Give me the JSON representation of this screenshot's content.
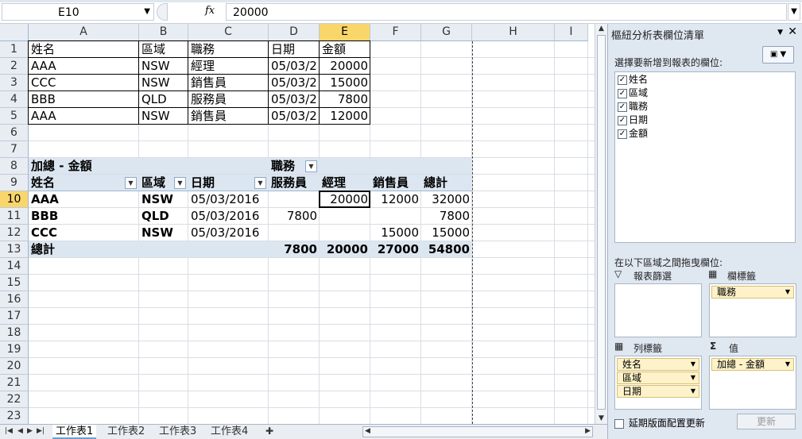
{
  "formula_bar": {
    "cell_ref": "E10",
    "fx": "fx",
    "value": "20000"
  },
  "columns": [
    "A",
    "B",
    "C",
    "D",
    "E",
    "F",
    "G",
    "H",
    "I"
  ],
  "selected_column": "E",
  "rows": [
    "1",
    "2",
    "3",
    "4",
    "5",
    "6",
    "7",
    "8",
    "9",
    "10",
    "11",
    "12",
    "13",
    "14",
    "15",
    "16",
    "17",
    "18",
    "19",
    "20",
    "21",
    "22",
    "23"
  ],
  "selected_row": "10",
  "source_table": {
    "headers": [
      "姓名",
      "區域",
      "職務",
      "日期",
      "金額"
    ],
    "rows": [
      [
        "AAA",
        "NSW",
        "經理",
        "05/03/2",
        "20000"
      ],
      [
        "CCC",
        "NSW",
        "銷售員",
        "05/03/2",
        "15000"
      ],
      [
        "BBB",
        "QLD",
        "服務員",
        "05/03/2",
        "7800"
      ],
      [
        "AAA",
        "NSW",
        "銷售員",
        "05/03/2",
        "12000"
      ]
    ]
  },
  "pivot": {
    "value_label": "加總 - 金額",
    "col_field": "職務",
    "row_headers": [
      "姓名",
      "區域",
      "日期"
    ],
    "col_headers": [
      "服務員",
      "經理",
      "銷售員",
      "總計"
    ],
    "rows": [
      [
        "AAA",
        "NSW",
        "05/03/2016",
        "",
        "20000",
        "12000",
        "32000"
      ],
      [
        "BBB",
        "QLD",
        "05/03/2016",
        "7800",
        "",
        "",
        "7800"
      ],
      [
        "CCC",
        "NSW",
        "05/03/2016",
        "",
        "",
        "15000",
        "15000"
      ]
    ],
    "total": [
      "總計",
      "",
      "",
      "7800",
      "20000",
      "27000",
      "54800"
    ]
  },
  "sheet_tabs": [
    "工作表1",
    "工作表2",
    "工作表3",
    "工作表4"
  ],
  "active_tab": "工作表1",
  "panel": {
    "title": "樞紐分析表欄位清單",
    "choose_label": "選擇要新增到報表的欄位:",
    "fields": [
      "姓名",
      "區域",
      "職務",
      "日期",
      "金額"
    ],
    "drag_label": "在以下區域之間拖曳欄位:",
    "zones": {
      "filter": "報表篩選",
      "columns": "欄標籤",
      "rows": "列標籤",
      "values": "值"
    },
    "column_chips": [
      "職務"
    ],
    "row_chips": [
      "姓名",
      "區域",
      "日期"
    ],
    "value_chips": [
      "加總 - 金額"
    ],
    "defer_label": "延期版面配置更新",
    "update_label": "更新"
  },
  "colors": {
    "header_bg": "#e8edf4",
    "selected_header": "#f8d66b",
    "pivot_band": "#dce6f1",
    "panel_bg": "#dfe7f1"
  }
}
